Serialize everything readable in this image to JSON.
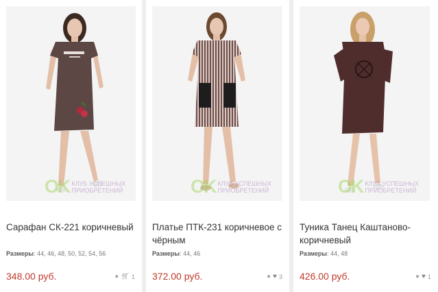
{
  "watermark": {
    "logo": "OK",
    "text": "КЛУБ УСПЕШНЫХ ПРИОБРЕТЕНИЙ"
  },
  "sizes_label": "Размеры",
  "products": [
    {
      "title": "Сарафан СК-221 коричневый",
      "sizes": "44, 46, 48, 50, 52, 54, 56",
      "price": "348.00 руб.",
      "count": "1",
      "secondary_icon": "cart-icon",
      "dress_color": "#5d4745"
    },
    {
      "title": "Платье ПТК-231 коричневое с чёрным",
      "sizes": "44, 46",
      "price": "372.00 руб.",
      "count": "3",
      "secondary_icon": "heart-icon",
      "dress_color": "#8a6f6c"
    },
    {
      "title": "Туника Танец Каштаново-коричневый",
      "sizes": "44, 48",
      "price": "426.00 руб.",
      "count": "1",
      "secondary_icon": "heart-icon",
      "dress_color": "#4f2d2d"
    }
  ]
}
